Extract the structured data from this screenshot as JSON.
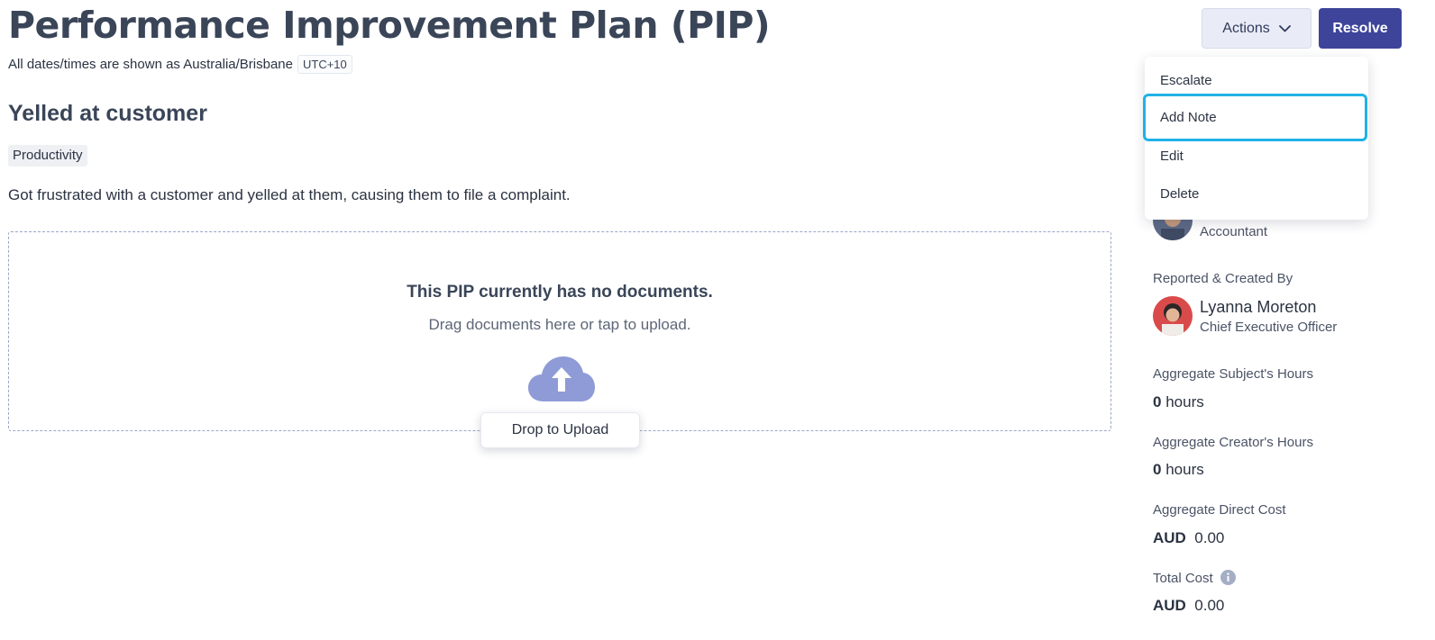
{
  "header": {
    "title": "Performance Improvement Plan (PIP)",
    "timezone_text": "All dates/times are shown as Australia/Brisbane",
    "timezone_badge": "UTC+10"
  },
  "issue": {
    "title": "Yelled at customer",
    "tag": "Productivity",
    "description": "Got frustrated with a customer and yelled at them, causing them to file a complaint."
  },
  "documents": {
    "empty_heading": "This PIP currently has no documents.",
    "empty_hint": "Drag documents here or tap to upload.",
    "drop_button": "Drop to Upload"
  },
  "toolbar": {
    "actions_label": "Actions",
    "resolve_label": "Resolve"
  },
  "actions_menu": {
    "items": [
      "Escalate",
      "Add Note",
      "Edit",
      "Delete"
    ],
    "focused": "Add Note"
  },
  "sidebar": {
    "subject_role": "Accountant",
    "reported_label": "Reported & Created By",
    "reporter_name": "Lyanna Moreton",
    "reporter_role": "Chief Executive Officer",
    "subject_hours_label": "Aggregate Subject's Hours",
    "subject_hours_value": "0",
    "creator_hours_label": "Aggregate Creator's Hours",
    "creator_hours_value": "0",
    "hours_unit": "hours",
    "direct_cost_label": "Aggregate Direct Cost",
    "direct_cost_currency": "AUD",
    "direct_cost_value": "0.00",
    "total_cost_label": "Total Cost",
    "total_cost_currency": "AUD",
    "total_cost_value": "0.00"
  },
  "colors": {
    "primary": "#3d4499",
    "focus_ring": "#1fb2e6",
    "upload_cloud": "#8e9bd6"
  }
}
